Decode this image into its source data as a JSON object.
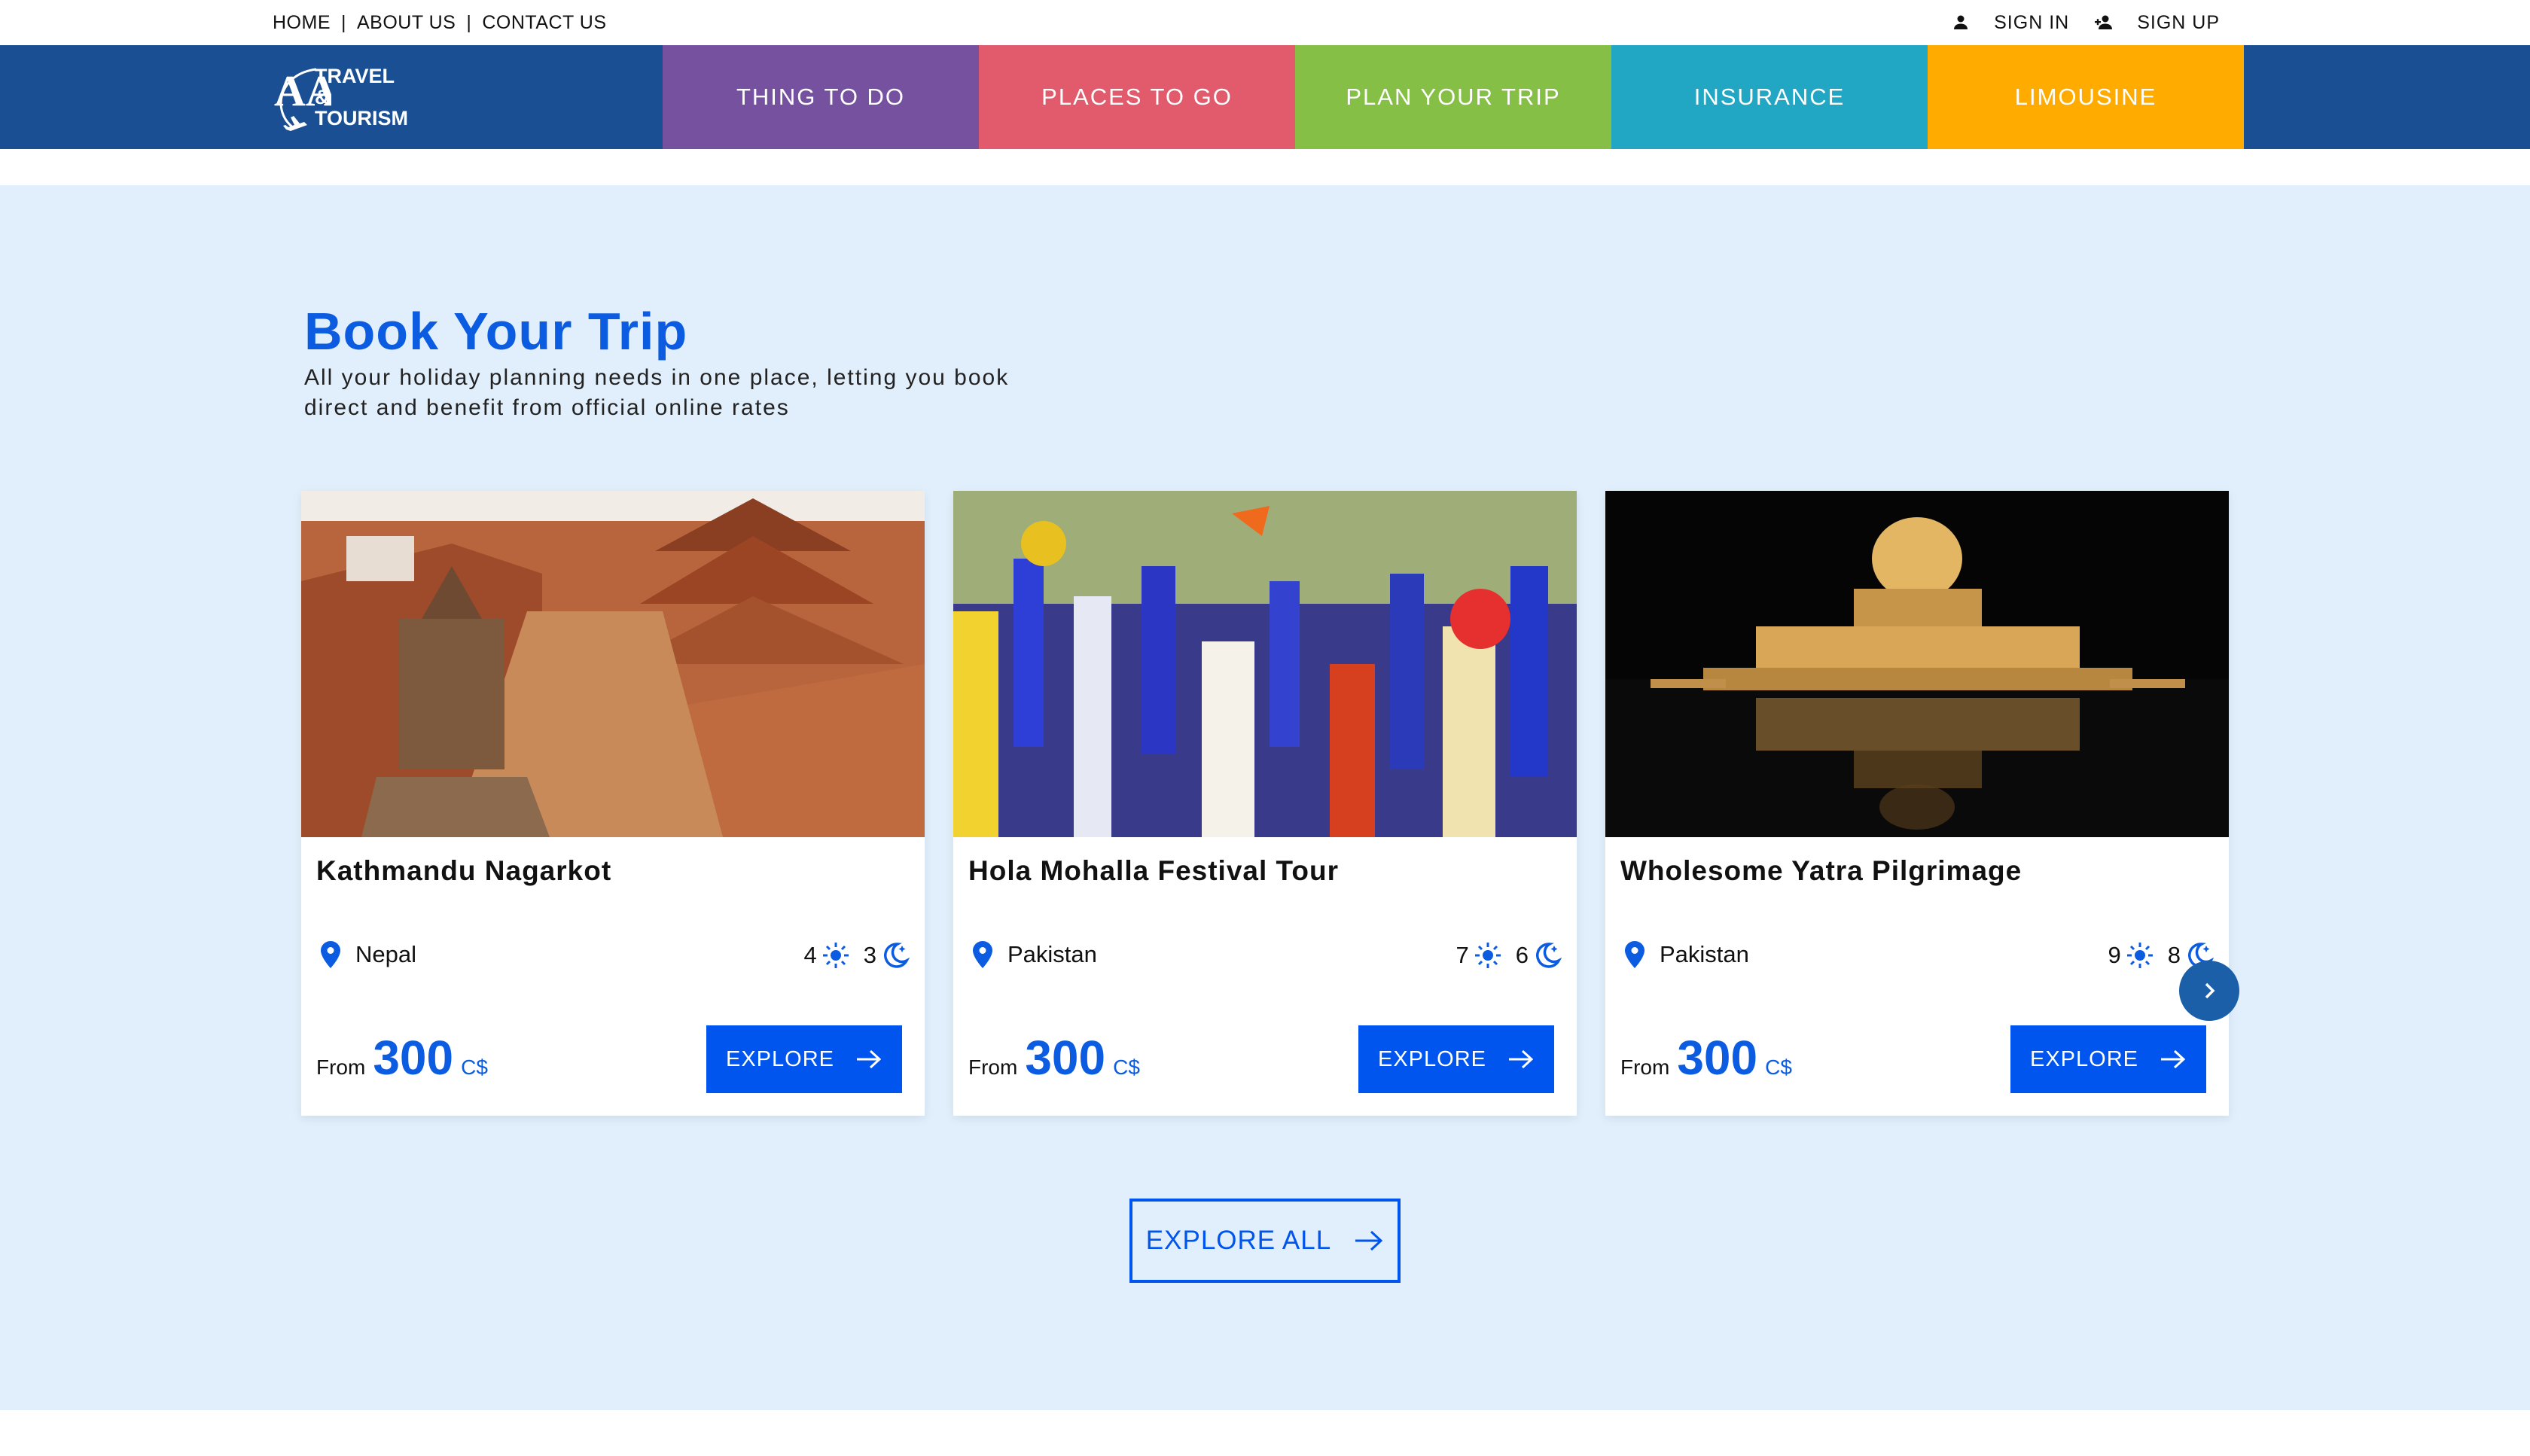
{
  "topbar": {
    "links": [
      "HOME",
      "ABOUT US",
      "CONTACT US"
    ],
    "separator": "|",
    "sign_in": "SIGN IN",
    "sign_up": "SIGN UP"
  },
  "logo": {
    "line1": "TRAVEL &",
    "line2": "TOURISM",
    "mark": "AA"
  },
  "nav": {
    "tabs": [
      {
        "label": "THING TO DO",
        "color": "#76519f"
      },
      {
        "label": "PLACES TO GO",
        "color": "#e15b6c"
      },
      {
        "label": "PLAN YOUR TRIP",
        "color": "#85bf45"
      },
      {
        "label": "INSURANCE",
        "color": "#21a6c3"
      },
      {
        "label": "LIMOUSINE",
        "color": "#ffab00"
      }
    ],
    "background": "#1a4f93"
  },
  "section": {
    "title": "Book Your Trip",
    "subtitle_line1": "All your holiday planning needs in one place, letting you book",
    "subtitle_line2": "direct and benefit from official online rates",
    "explore_all": "EXPLORE ALL"
  },
  "cards": [
    {
      "title": "Kathmandu Nagarkot",
      "location": "Nepal",
      "days": "4",
      "nights": "3",
      "from": "From",
      "price": "300",
      "currency": "C$",
      "button": "EXPLORE",
      "image": "temple-city-photo"
    },
    {
      "title": "Hola Mohalla Festival Tour",
      "location": "Pakistan",
      "days": "7",
      "nights": "6",
      "from": "From",
      "price": "300",
      "currency": "C$",
      "button": "EXPLORE",
      "image": "festival-crowd-photo"
    },
    {
      "title": "Wholesome Yatra Pilgrimage",
      "location": "Pakistan",
      "days": "9",
      "nights": "8",
      "from": "From",
      "price": "300",
      "currency": "C$",
      "button": "EXPLORE",
      "image": "gurdwara-night-photo"
    }
  ],
  "colors": {
    "accent": "#0055ee",
    "title_blue": "#0b5ce0",
    "section_bg": "#e1effc"
  }
}
